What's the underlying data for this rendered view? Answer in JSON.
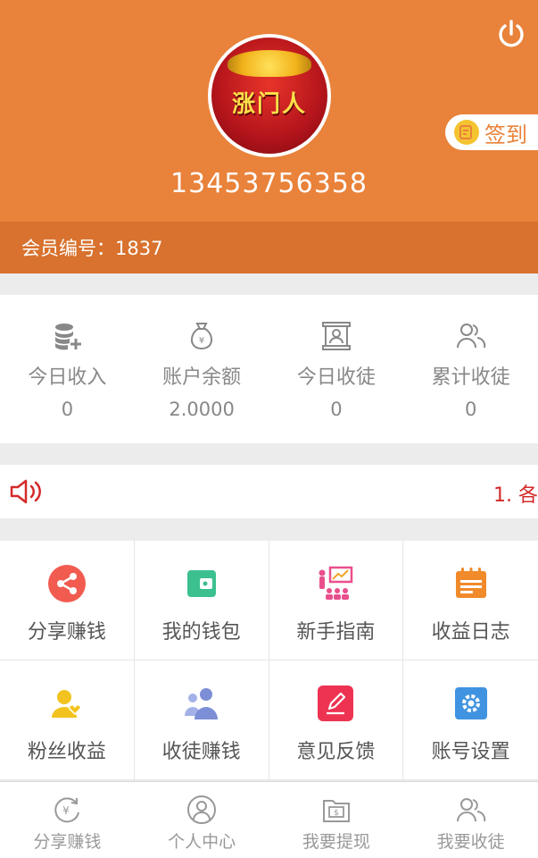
{
  "header": {
    "avatar_text": "涨门人",
    "phone": "13453756358",
    "checkin_label": "签到",
    "bg_color": "#e9823a"
  },
  "member": {
    "label": "会员编号：1837"
  },
  "stats": [
    {
      "icon": "coins-add-icon",
      "label": "今日收入",
      "value": "0"
    },
    {
      "icon": "money-bag-icon",
      "label": "账户余额",
      "value": "2.0000"
    },
    {
      "icon": "scroll-portrait-icon",
      "label": "今日收徒",
      "value": "0"
    },
    {
      "icon": "users-icon",
      "label": "累计收徒",
      "value": "0"
    }
  ],
  "notice": {
    "text": "1. 各"
  },
  "menu": [
    {
      "icon": "share-icon",
      "label": "分享赚钱",
      "color": "#f25b4f"
    },
    {
      "icon": "wallet-icon",
      "label": "我的钱包",
      "color": "#3cc08f"
    },
    {
      "icon": "presentation-icon",
      "label": "新手指南",
      "color": "#e94f8c"
    },
    {
      "icon": "calendar-log-icon",
      "label": "收益日志",
      "color": "#f08a2a"
    },
    {
      "icon": "fan-user-icon",
      "label": "粉丝收益",
      "color": "#f2c31e"
    },
    {
      "icon": "group-users-icon",
      "label": "收徒赚钱",
      "color": "#7c8fd6"
    },
    {
      "icon": "feedback-pen-icon",
      "label": "意见反馈",
      "color": "#ee3352"
    },
    {
      "icon": "gear-icon",
      "label": "账号设置",
      "color": "#3f93e0"
    }
  ],
  "tabbar": [
    {
      "icon": "yuan-refresh-icon",
      "label": "分享赚钱"
    },
    {
      "icon": "person-circle-icon",
      "label": "个人中心"
    },
    {
      "icon": "folder-cash-icon",
      "label": "我要提现"
    },
    {
      "icon": "users-icon",
      "label": "我要收徒"
    }
  ]
}
